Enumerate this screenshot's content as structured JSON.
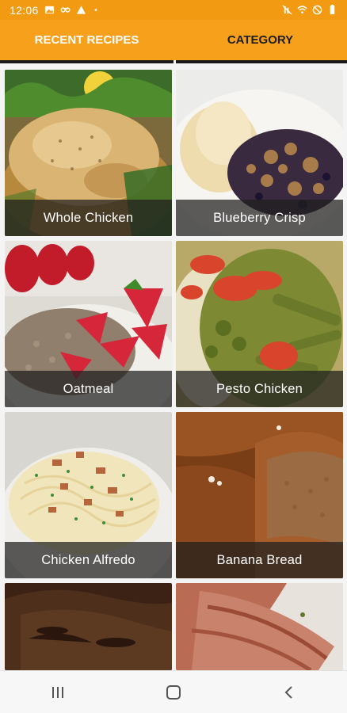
{
  "status_bar": {
    "time": "12:06",
    "icons_left": [
      "image-icon",
      "voicemail-icon",
      "triangle-alert-icon",
      "dot-icon"
    ],
    "icons_right": [
      "mute-icon",
      "wifi-icon",
      "dnd-icon",
      "battery-icon"
    ]
  },
  "tabs": [
    {
      "label": "RECENT RECIPES"
    },
    {
      "label": "CATEGORY"
    }
  ],
  "recipes": [
    {
      "title": "Whole Chicken"
    },
    {
      "title": "Blueberry Crisp"
    },
    {
      "title": "Oatmeal"
    },
    {
      "title": "Pesto Chicken"
    },
    {
      "title": "Chicken Alfredo"
    },
    {
      "title": "Banana Bread"
    }
  ],
  "nav": {
    "icons": [
      "recents-icon",
      "home-icon",
      "back-icon"
    ]
  },
  "colors": {
    "app_bar": "#f6a01b",
    "status_bar": "#f29a12",
    "tab_indicator": "#1a1a1a",
    "card_label_band": "#1e1e1e"
  }
}
